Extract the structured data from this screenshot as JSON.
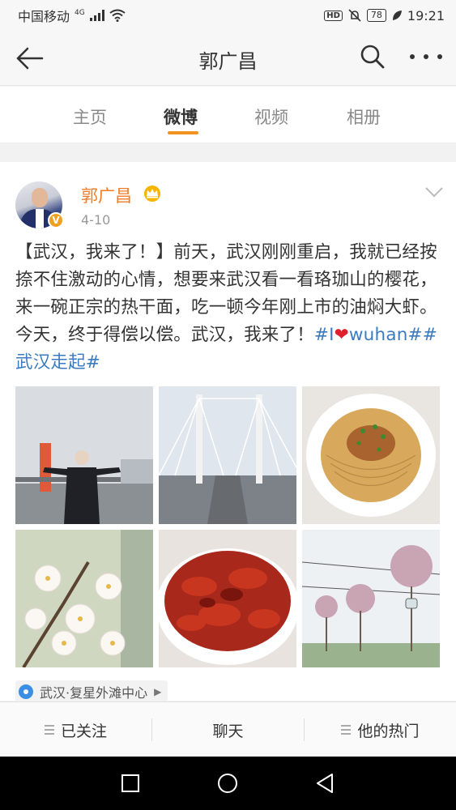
{
  "status_bar": {
    "carrier": "中国移动",
    "network": "4G",
    "hd": "HD",
    "battery": "78",
    "time": "19:21"
  },
  "header": {
    "title": "郭广昌"
  },
  "tabs": [
    {
      "label": "主页",
      "active": false
    },
    {
      "label": "微博",
      "active": true
    },
    {
      "label": "视频",
      "active": false
    },
    {
      "label": "相册",
      "active": false
    }
  ],
  "post": {
    "author": "郭广昌",
    "date": "4-10",
    "text_main": "【武汉，我来了！】前天，武汉刚刚重启，我就已经按捺不住激动的心情，想要来武汉看一看珞珈山的樱花，来一碗正宗的热干面，吃一顿今年刚上市的油焖大虾。今天，终于得偿以偿。武汉，我来了！",
    "tag1_prefix": "#I",
    "tag1_heart": "❤",
    "tag1_suffix": "wuhan#",
    "tag2": "#武汉走起#",
    "location": "武汉·复星外滩中心",
    "photos": [
      "man-on-bridge-photo",
      "bridge-photo",
      "hot-dry-noodles-photo",
      "cherry-blossom-photo",
      "crayfish-photo",
      "cable-car-blossom-photo"
    ]
  },
  "bottom_bar": {
    "follow_label": "已关注",
    "chat_label": "聊天",
    "hot_label": "他的热门"
  },
  "colors": {
    "accent": "#f29221",
    "username": "#f07c28",
    "topic_link": "#3b7bc0"
  }
}
